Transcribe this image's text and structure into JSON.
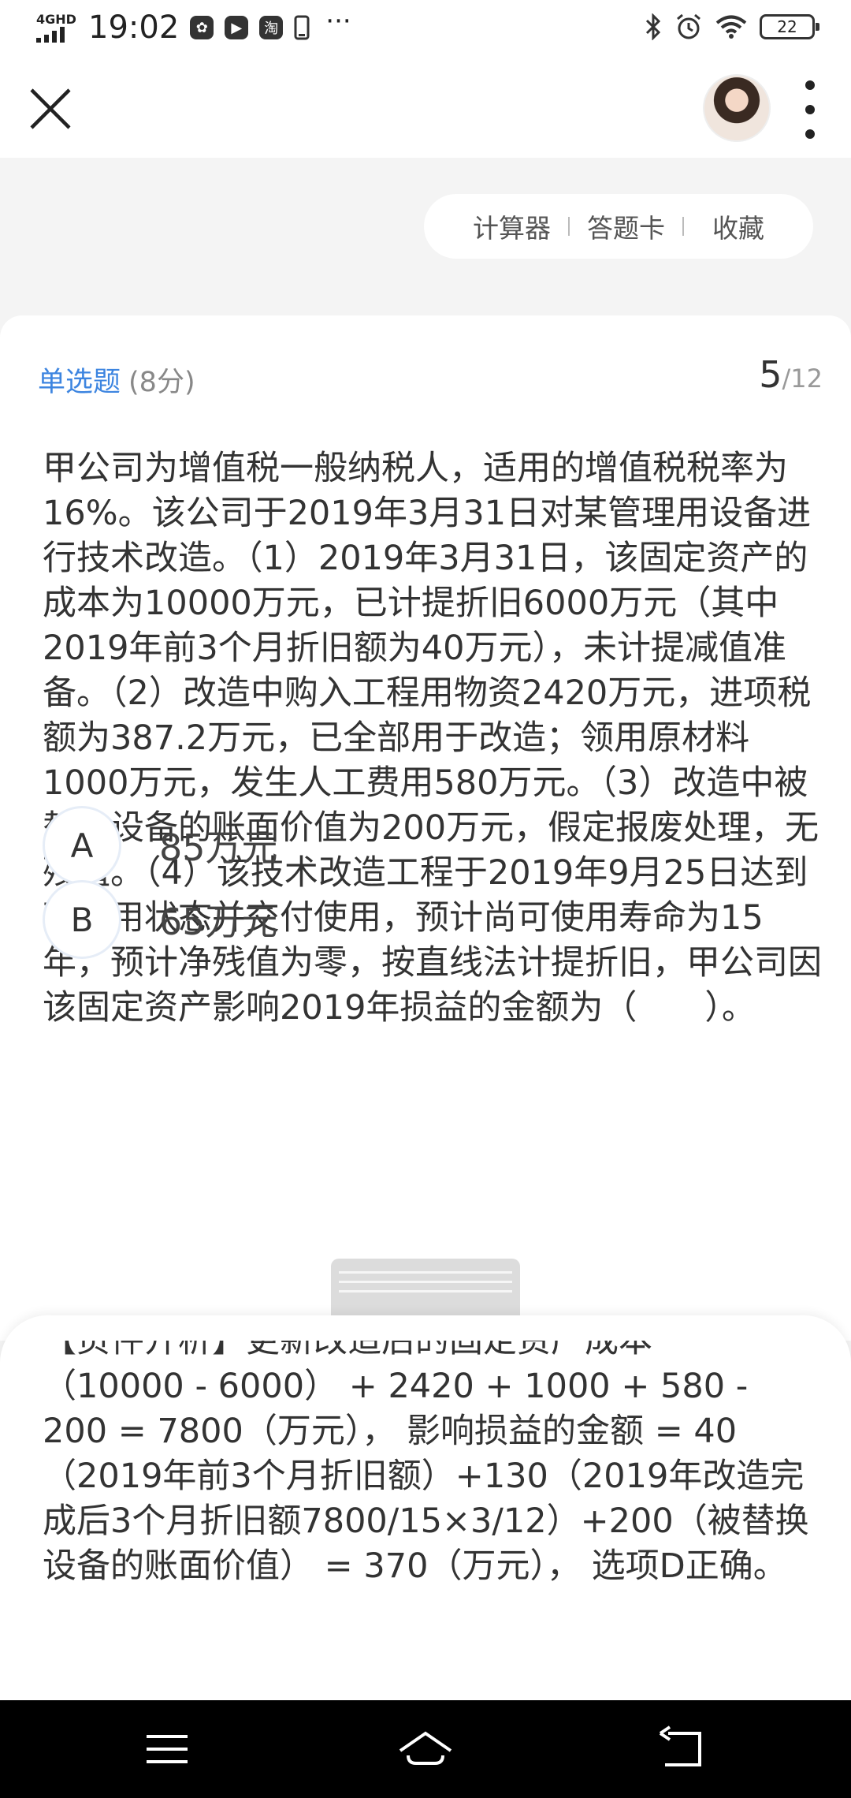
{
  "status_bar": {
    "network": "4GHD",
    "time": "19:02",
    "app_icons": [
      "wechat-icon",
      "video-icon",
      "taobao-icon",
      "phone-icon"
    ],
    "more": "···",
    "battery": "22"
  },
  "toolbar": {
    "calculator": "计算器",
    "answer_card": "答题卡",
    "favorite": "收藏"
  },
  "question": {
    "type": "单选题",
    "score": "(8分)",
    "current": "5",
    "total": "/12",
    "text": "甲公司为增值税一般纳税人，适用的增值税税率为16%。该公司于2019年3月31日对某管理用设备进行技术改造。（1）2019年3月31日，该固定资产的成本为10000万元，已计提折旧6000万元（其中2019年前3个月折旧额为40万元），未计提减值准备。（2）改造中购入工程用物资2420万元，进项税额为387.2万元，已全部用于改造；领用原材料1000万元，发生人工费用580万元。（3）改造中被替换设备的账面价值为200万元，假定报废处理，无残值。（4）该技术改造工程于2019年9月25日达到可使用状态并交付使用，预计尚可使用寿命为15年，预计净残值为零，按直线法计提折旧，甲公司因该固定资产影响2019年损益的金额为（　　）。",
    "options": [
      {
        "letter": "A",
        "text": "85万元"
      },
      {
        "letter": "B",
        "text": "65万元"
      }
    ]
  },
  "analysis": {
    "partial_line": "【页件开析】更新改造后的固定资产成本",
    "text": "（10000 - 6000） + 2420 + 1000 + 580 - 200 = 7800（万元）， 影响损益的金额 = 40（2019年前3个月折旧额）+130（2019年改造完成后3个月折旧额7800/15×3/12）+200（被替换设备的账面价值） = 370（万元）， 选项D正确。"
  },
  "colors": {
    "accent": "#3d85e0",
    "background": "#f4f4f4",
    "card": "#ffffff",
    "navbar": "#000000"
  }
}
